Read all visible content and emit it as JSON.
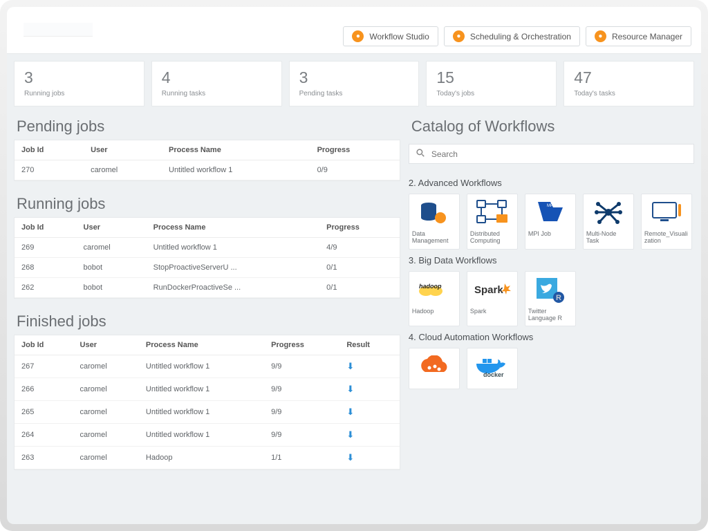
{
  "topbar": {
    "links": [
      {
        "label": "Workflow Studio",
        "icon": "workflow-studio-icon"
      },
      {
        "label": "Scheduling & Orchestration",
        "icon": "scheduling-icon"
      },
      {
        "label": "Resource Manager",
        "icon": "resource-manager-icon"
      }
    ]
  },
  "stats": [
    {
      "value": "3",
      "label": "Running jobs"
    },
    {
      "value": "4",
      "label": "Running tasks"
    },
    {
      "value": "3",
      "label": "Pending tasks"
    },
    {
      "value": "15",
      "label": "Today's jobs"
    },
    {
      "value": "47",
      "label": "Today's tasks"
    }
  ],
  "pending_jobs": {
    "title": "Pending jobs",
    "headers": {
      "id": "Job Id",
      "user": "User",
      "process": "Process Name",
      "progress": "Progress"
    },
    "rows": [
      {
        "id": "270",
        "user": "caromel",
        "process": "Untitled workflow 1",
        "progress": "0/9"
      }
    ]
  },
  "running_jobs": {
    "title": "Running jobs",
    "headers": {
      "id": "Job Id",
      "user": "User",
      "process": "Process Name",
      "progress": "Progress"
    },
    "rows": [
      {
        "id": "269",
        "user": "caromel",
        "process": "Untitled workflow 1",
        "progress": "4/9"
      },
      {
        "id": "268",
        "user": "bobot",
        "process": "StopProactiveServerU ...",
        "progress": "0/1"
      },
      {
        "id": "262",
        "user": "bobot",
        "process": "RunDockerProactiveSe ...",
        "progress": "0/1"
      }
    ]
  },
  "finished_jobs": {
    "title": "Finished jobs",
    "headers": {
      "id": "Job Id",
      "user": "User",
      "process": "Process Name",
      "progress": "Progress",
      "result": "Result"
    },
    "rows": [
      {
        "id": "267",
        "user": "caromel",
        "process": "Untitled workflow 1",
        "progress": "9/9"
      },
      {
        "id": "266",
        "user": "caromel",
        "process": "Untitled workflow 1",
        "progress": "9/9"
      },
      {
        "id": "265",
        "user": "caromel",
        "process": "Untitled workflow 1",
        "progress": "9/9"
      },
      {
        "id": "264",
        "user": "caromel",
        "process": "Untitled workflow 1",
        "progress": "9/9"
      },
      {
        "id": "263",
        "user": "caromel",
        "process": "Hadoop",
        "progress": "1/1"
      }
    ]
  },
  "catalog": {
    "title": "Catalog of Workflows",
    "search_placeholder": "Search",
    "sections": [
      {
        "title": "2. Advanced Workflows",
        "items": [
          {
            "label": "Data Management",
            "icon": "data-management-icon"
          },
          {
            "label": "Distributed Computing",
            "icon": "distributed-computing-icon"
          },
          {
            "label": "MPI Job",
            "icon": "mpi-icon"
          },
          {
            "label": "Multi-Node Task",
            "icon": "multinode-icon"
          },
          {
            "label": "Remote_Visualization",
            "icon": "remote-viz-icon"
          }
        ]
      },
      {
        "title": "3. Big Data Workflows",
        "items": [
          {
            "label": "Hadoop",
            "icon": "hadoop-icon"
          },
          {
            "label": "Spark",
            "icon": "spark-icon"
          },
          {
            "label": "Twitter Language R",
            "icon": "twitter-r-icon"
          }
        ]
      },
      {
        "title": "4. Cloud Automation Workflows",
        "items": [
          {
            "label": "",
            "icon": "cloud-icon"
          },
          {
            "label": "",
            "icon": "docker-icon"
          }
        ]
      }
    ]
  }
}
